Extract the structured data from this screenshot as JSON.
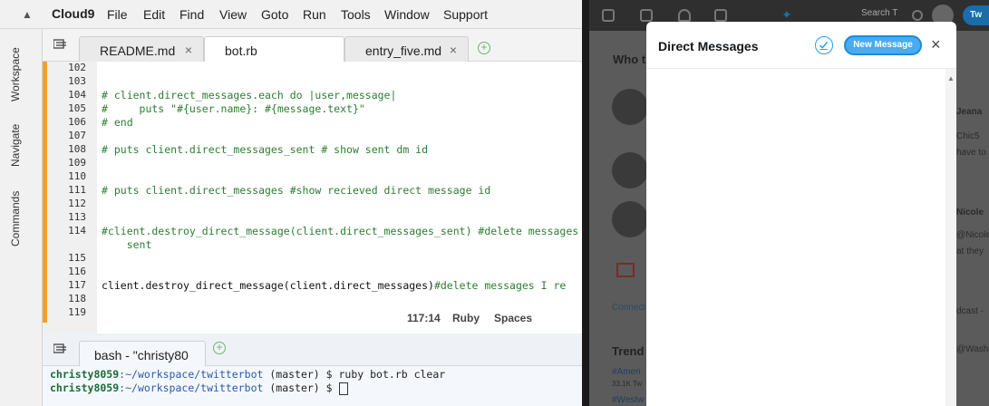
{
  "c9": {
    "brand": "Cloud9",
    "menu": [
      "File",
      "Edit",
      "Find",
      "View",
      "Goto",
      "Run",
      "Tools",
      "Window",
      "Support"
    ],
    "side_tabs": [
      "Workspace",
      "Navigate",
      "Commands"
    ],
    "tabs": [
      {
        "label": "README.md",
        "close": "×"
      },
      {
        "label": "bot.rb",
        "close": ""
      },
      {
        "label": "entry_five.md",
        "close": "×"
      }
    ],
    "add_tab": "+",
    "lines": [
      {
        "n": "102",
        "text": ""
      },
      {
        "n": "103",
        "text": ""
      },
      {
        "n": "104",
        "text": "# client.direct_messages.each do |user,message|"
      },
      {
        "n": "105",
        "text": "#     puts \"#{user.name}: #{message.text}\""
      },
      {
        "n": "106",
        "text": "# end"
      },
      {
        "n": "107",
        "text": ""
      },
      {
        "n": "108",
        "text": "# puts client.direct_messages_sent # show sent dm id"
      },
      {
        "n": "109",
        "text": ""
      },
      {
        "n": "110",
        "text": ""
      },
      {
        "n": "111",
        "text": "# puts client.direct_messages #show recieved direct message id"
      },
      {
        "n": "112",
        "text": ""
      },
      {
        "n": "113",
        "text": ""
      },
      {
        "n": "114",
        "text": "#client.destroy_direct_message(client.direct_messages_sent) #delete messages I"
      },
      {
        "n": "",
        "text": "    sent"
      },
      {
        "n": "115",
        "text": ""
      },
      {
        "n": "116",
        "text": ""
      },
      {
        "n": "117",
        "text": "client.destroy_direct_message(client.direct_messages)",
        "comment": "#delete messages I re"
      },
      {
        "n": "118",
        "text": ""
      },
      {
        "n": "119",
        "text": ""
      }
    ],
    "status": {
      "position": "117:14",
      "language": "Ruby",
      "indent": "Spaces"
    },
    "terminal": {
      "tab": "bash - \"christy80",
      "add": "+",
      "lines": [
        {
          "user": "christy8059",
          "path": ":~/workspace/twitterbot",
          "rest": " (master) $ ruby bot.rb clear"
        },
        {
          "user": "christy8059",
          "path": ":~/workspace/twitterbot",
          "rest": " (master) $ "
        }
      ]
    }
  },
  "twitter": {
    "search_placeholder": "Search T",
    "tweet_btn": "Tw",
    "bg": {
      "who_to_follow": "Who t",
      "name1": "Jeana",
      "handle1": "Chic5",
      "text1": "have to",
      "name2": "Nicole",
      "handle2": "@Nicole",
      "text2": "at they",
      "connect": "Connect",
      "podcast": "dcast -",
      "trends": "Trend",
      "trend1": "#Ameri",
      "trend1_count": "33.1K Tw",
      "trend2": "#Westw",
      "wash": "@Washi"
    },
    "dm": {
      "title": "Direct Messages",
      "new_message": "New Message",
      "close": "×"
    }
  }
}
